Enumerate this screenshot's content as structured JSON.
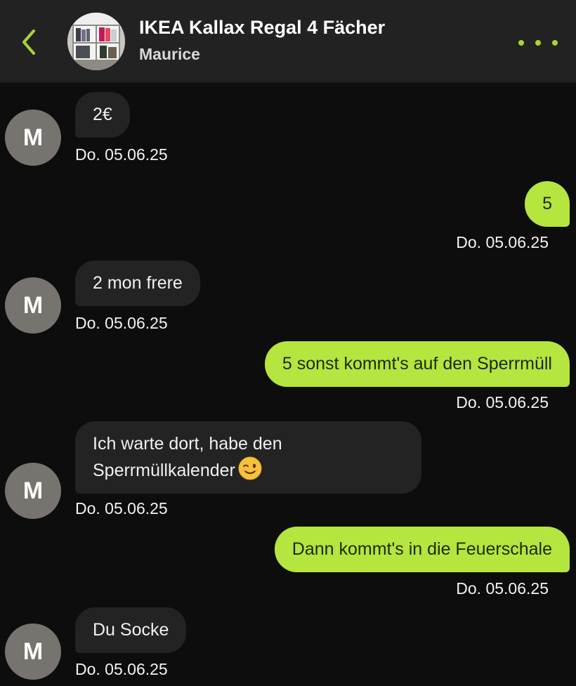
{
  "header": {
    "title": "IKEA Kallax Regal 4 Fächer",
    "subtitle": "Maurice",
    "back_icon": "chevron-left-icon",
    "more_icon": "more-dots-icon"
  },
  "colors": {
    "accent": "#a5d63a",
    "outgoing_bubble": "#b5e53f",
    "incoming_bubble": "#232323",
    "avatar": "#77746f",
    "header": "#222222",
    "background": "#0d0d0d"
  },
  "contact": {
    "initial": "M"
  },
  "messages": [
    {
      "direction": "in",
      "text": "2€",
      "time": "Do. 05.06.25"
    },
    {
      "direction": "out",
      "text": "5",
      "time": "Do. 05.06.25"
    },
    {
      "direction": "in",
      "text": "2 mon frere",
      "time": "Do. 05.06.25"
    },
    {
      "direction": "out",
      "text": "5 sonst kommt's auf den Sperrmüll",
      "time": "Do. 05.06.25"
    },
    {
      "direction": "in",
      "text_line1": "Ich warte dort, habe den",
      "text_line2": "Sperrmüllkalender",
      "emoji": "winking-face-emoji",
      "time": "Do. 05.06.25"
    },
    {
      "direction": "out",
      "text": "Dann kommt's in die Feuerschale",
      "time": "Do. 05.06.25"
    },
    {
      "direction": "in",
      "text": "Du Socke",
      "time": "Do. 05.06.25"
    }
  ]
}
